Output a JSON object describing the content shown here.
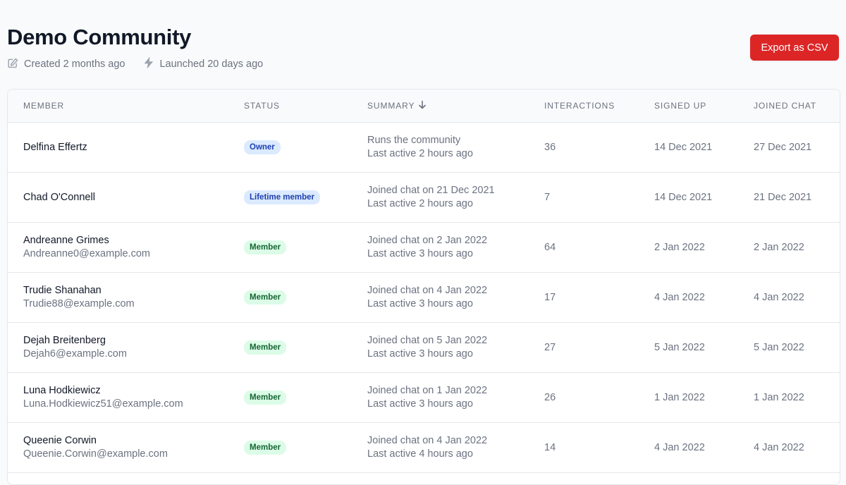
{
  "page": {
    "title": "Demo Community",
    "created": "Created 2 months ago",
    "launched": "Launched 20 days ago",
    "export_label": "Export as CSV"
  },
  "table": {
    "headers": {
      "member": "MEMBER",
      "status": "STATUS",
      "summary": "SUMMARY",
      "interactions": "INTERACTIONS",
      "signed_up": "SIGNED UP",
      "joined_chat": "JOINED CHAT"
    },
    "rows": [
      {
        "name": "Delfina Effertz",
        "email": "",
        "status": "Owner",
        "status_kind": "owner",
        "summary1": "Runs the community",
        "summary2": "Last active 2 hours ago",
        "interactions": "36",
        "signed_up": "14 Dec 2021",
        "joined_chat": "27 Dec 2021"
      },
      {
        "name": "Chad O'Connell",
        "email": "",
        "status": "Lifetime member",
        "status_kind": "lifetime",
        "summary1": "Joined chat on 21 Dec 2021",
        "summary2": "Last active 2 hours ago",
        "interactions": "7",
        "signed_up": "14 Dec 2021",
        "joined_chat": "21 Dec 2021"
      },
      {
        "name": "Andreanne Grimes",
        "email": "Andreanne0@example.com",
        "status": "Member",
        "status_kind": "member",
        "summary1": "Joined chat on 2 Jan 2022",
        "summary2": "Last active 3 hours ago",
        "interactions": "64",
        "signed_up": "2 Jan 2022",
        "joined_chat": "2 Jan 2022"
      },
      {
        "name": "Trudie Shanahan",
        "email": "Trudie88@example.com",
        "status": "Member",
        "status_kind": "member",
        "summary1": "Joined chat on 4 Jan 2022",
        "summary2": "Last active 3 hours ago",
        "interactions": "17",
        "signed_up": "4 Jan 2022",
        "joined_chat": "4 Jan 2022"
      },
      {
        "name": "Dejah Breitenberg",
        "email": "Dejah6@example.com",
        "status": "Member",
        "status_kind": "member",
        "summary1": "Joined chat on 5 Jan 2022",
        "summary2": "Last active 3 hours ago",
        "interactions": "27",
        "signed_up": "5 Jan 2022",
        "joined_chat": "5 Jan 2022"
      },
      {
        "name": "Luna Hodkiewicz",
        "email": "Luna.Hodkiewicz51@example.com",
        "status": "Member",
        "status_kind": "member",
        "summary1": "Joined chat on 1 Jan 2022",
        "summary2": "Last active 3 hours ago",
        "interactions": "26",
        "signed_up": "1 Jan 2022",
        "joined_chat": "1 Jan 2022"
      },
      {
        "name": "Queenie Corwin",
        "email": "Queenie.Corwin@example.com",
        "status": "Member",
        "status_kind": "member",
        "summary1": "Joined chat on 4 Jan 2022",
        "summary2": "Last active 4 hours ago",
        "interactions": "14",
        "signed_up": "4 Jan 2022",
        "joined_chat": "4 Jan 2022"
      }
    ]
  },
  "icons": {
    "created": "pencil-square-icon",
    "launched": "lightning-bolt-icon",
    "sort": "arrow-down-icon"
  },
  "colors": {
    "accent": "#dc2626",
    "badge_blue_bg": "#dbeafe",
    "badge_green_bg": "#dcfce7"
  }
}
